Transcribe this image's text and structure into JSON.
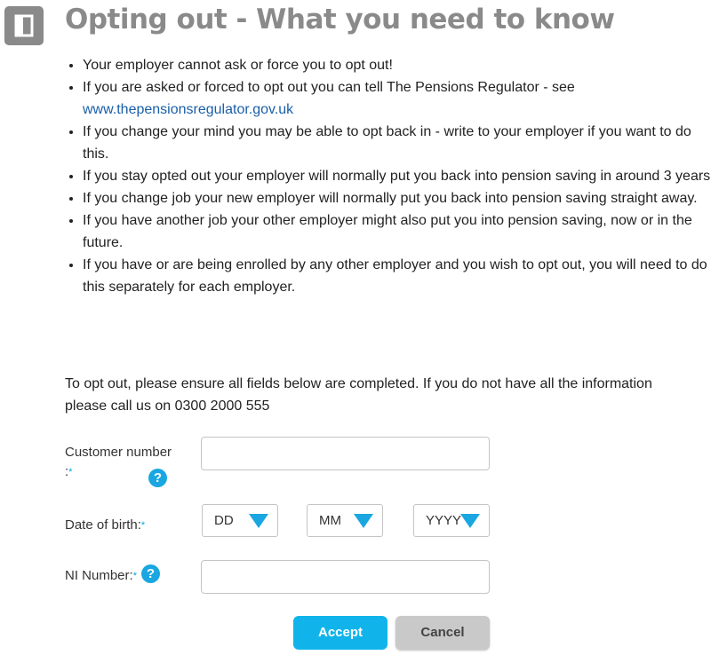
{
  "header": {
    "icon": "door-exit-icon",
    "title": "Opting out - What you need to know"
  },
  "bullets": [
    {
      "text": "Your employer cannot ask or force you to opt out!"
    },
    {
      "text": "If you are asked or forced to opt out you can tell The Pensions Regulator - see",
      "link": "www.thepensionsregulator.gov.uk"
    },
    {
      "text": "If you change your mind you may be able to opt back in - write to your employer if you want to do this."
    },
    {
      "text": "If you stay opted out your employer will normally put you back into pension saving in around 3 years."
    },
    {
      "text": "If you change job your new employer will normally put you back into pension saving straight away."
    },
    {
      "text": "If you have another job your other employer might also put you into pension saving, now or in the future."
    },
    {
      "text": "If you have or are being enrolled by any other employer and you wish to opt out, you will need to do this separately for each employer."
    }
  ],
  "intro": "To opt out, please ensure all fields below are completed. If you do not have all the information please call us on 0300 2000 555",
  "form": {
    "required_mark": "*",
    "customer_number": {
      "label_line1": "Customer number",
      "label_line2": ":",
      "value": "",
      "help_icon": "?"
    },
    "date_of_birth": {
      "label": "Date of birth:",
      "day": "DD",
      "month": "MM",
      "year": "YYYY"
    },
    "ni_number": {
      "label": "NI Number:",
      "value": "",
      "help_icon": "?"
    }
  },
  "buttons": {
    "accept": "Accept",
    "cancel": "Cancel"
  },
  "colors": {
    "accent": "#1aa7e1",
    "title_gray": "#8a8a8a",
    "link": "#1a5fa8"
  }
}
